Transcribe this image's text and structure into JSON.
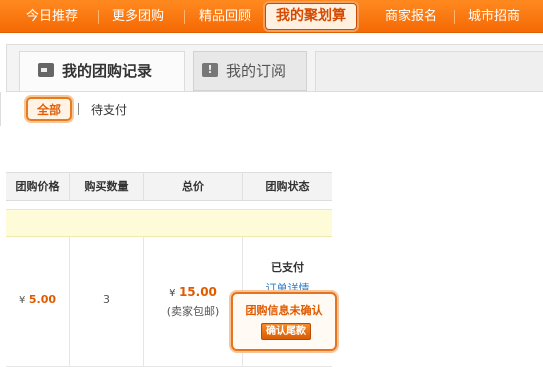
{
  "topnav": {
    "items": [
      {
        "label": "今日推荐"
      },
      {
        "label": "更多团购"
      },
      {
        "label": "精品回顾"
      },
      {
        "label": "我的聚划算"
      },
      {
        "label": "商家报名"
      },
      {
        "label": "城市招商"
      }
    ],
    "active_index": 3
  },
  "tabs": {
    "records": "我的团购记录",
    "subscriptions": "我的订阅"
  },
  "filters": {
    "all": "全部",
    "pending": "待支付"
  },
  "table": {
    "headers": [
      "团购价格",
      "购买数量",
      "总价",
      "团购状态"
    ],
    "row": {
      "currency": "¥",
      "price": "5.00",
      "quantity": "3",
      "total": "15.00",
      "shipping_note": "(卖家包邮)",
      "status_paid": "已支付",
      "order_detail_link": "订单详情",
      "status_warning": "团购信息未确认",
      "confirm_button": "确认尾款"
    }
  },
  "colors": {
    "nav_orange": "#f56a05",
    "accent": "#e05a00",
    "link": "#2a7ccf",
    "group_bar": "#fefbd9"
  }
}
